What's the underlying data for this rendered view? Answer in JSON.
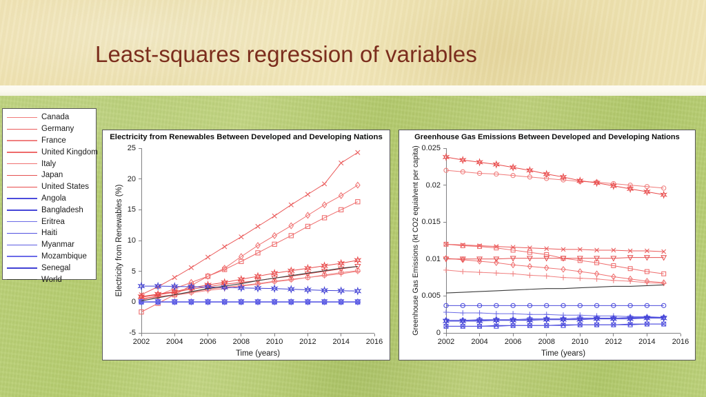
{
  "slide": {
    "title": "Least-squares regression of variables",
    "banner_color": "#efe2b2",
    "body_color": "#b6cd70",
    "title_color": "#7b2d1d"
  },
  "legend": {
    "developed_color": "#f0716f",
    "developing_color": "#4a4ae0",
    "world_color": "#3a3a3a",
    "items": [
      {
        "label": "Canada",
        "marker": "circle",
        "color": "#f07a79",
        "group": "developed"
      },
      {
        "label": "Germany",
        "marker": "x",
        "color": "#ea5a5a",
        "group": "developed"
      },
      {
        "label": "France",
        "marker": "plus",
        "color": "#f08080",
        "group": "developed"
      },
      {
        "label": "United Kingdom",
        "marker": "square",
        "color": "#ee6a6a",
        "group": "developed"
      },
      {
        "label": "Italy",
        "marker": "diamond",
        "color": "#ef6f6f",
        "group": "developed"
      },
      {
        "label": "Japan",
        "marker": "triangle",
        "color": "#e55050",
        "group": "developed"
      },
      {
        "label": "United States",
        "marker": "star",
        "color": "#e84a4a",
        "group": "developed"
      },
      {
        "label": "Angola",
        "marker": "circle",
        "color": "#4b4bdc",
        "group": "developing"
      },
      {
        "label": "Bangladesh",
        "marker": "x",
        "color": "#4545d8",
        "group": "developing"
      },
      {
        "label": "Eritrea",
        "marker": "plus",
        "color": "#6a6ae6",
        "group": "developing"
      },
      {
        "label": "Haiti",
        "marker": "square",
        "color": "#5050e0",
        "group": "developing"
      },
      {
        "label": "Myanmar",
        "marker": "diamond",
        "color": "#5a5ae2",
        "group": "developing"
      },
      {
        "label": "Mozambique",
        "marker": "triangle",
        "color": "#6b6be8",
        "group": "developing"
      },
      {
        "label": "Senegal",
        "marker": "star",
        "color": "#4040d4",
        "group": "developing"
      },
      {
        "label": "World",
        "marker": "none",
        "color": "#3a3a3a",
        "group": "world"
      }
    ]
  },
  "chart_data": [
    {
      "id": "electricity",
      "type": "line",
      "title": "Electricity from Renewables Between Developed and Developing Nations",
      "xlabel": "Time (years)",
      "ylabel": "Electricity from Renewables (%)",
      "xlim": [
        2002,
        2016
      ],
      "ylim": [
        -5,
        25
      ],
      "xticks": [
        2002,
        2004,
        2006,
        2008,
        2010,
        2012,
        2014,
        2016
      ],
      "yticks": [
        -5,
        0,
        5,
        10,
        15,
        20,
        25
      ],
      "grid": false,
      "legend_position": "external-left",
      "x": [
        2002,
        2003,
        2004,
        2005,
        2006,
        2007,
        2008,
        2009,
        2010,
        2011,
        2012,
        2013,
        2014,
        2015
      ],
      "series": [
        {
          "name": "Canada",
          "marker": "circle",
          "color": "#f07a79",
          "values": [
            0.6,
            0.9,
            1.2,
            1.6,
            2.1,
            2.4,
            2.7,
            3.0,
            3.4,
            3.7,
            4.0,
            4.4,
            4.8,
            5.1
          ]
        },
        {
          "name": "Germany",
          "marker": "x",
          "color": "#ea5a5a",
          "values": [
            1.2,
            2.5,
            4.0,
            5.6,
            7.3,
            9.0,
            10.6,
            12.3,
            14.0,
            15.8,
            17.5,
            19.2,
            22.6,
            24.3
          ]
        },
        {
          "name": "France",
          "marker": "plus",
          "color": "#f08080",
          "values": [
            0.5,
            0.8,
            1.1,
            1.5,
            1.9,
            2.2,
            2.6,
            2.9,
            3.3,
            3.6,
            4.0,
            4.3,
            4.6,
            5.0
          ]
        },
        {
          "name": "United Kingdom",
          "marker": "square",
          "color": "#ee6a6a",
          "values": [
            -1.6,
            -0.2,
            1.2,
            2.7,
            4.2,
            5.3,
            6.6,
            8.0,
            9.4,
            10.8,
            12.3,
            13.7,
            15.0,
            16.3
          ]
        },
        {
          "name": "Italy",
          "marker": "diamond",
          "color": "#ef6f6f",
          "values": [
            0.3,
            1.1,
            2.2,
            3.2,
            4.2,
            5.5,
            7.4,
            9.2,
            10.8,
            12.4,
            14.1,
            15.8,
            17.3,
            19.0
          ]
        },
        {
          "name": "Japan",
          "marker": "triangle",
          "color": "#e55050",
          "values": [
            0.8,
            1.2,
            1.6,
            2.1,
            2.5,
            2.9,
            3.2,
            3.5,
            3.9,
            4.2,
            4.6,
            5.0,
            5.4,
            5.8
          ]
        },
        {
          "name": "United States",
          "marker": "star",
          "color": "#e84a4a",
          "values": [
            0.9,
            1.3,
            1.7,
            2.3,
            2.8,
            3.2,
            3.7,
            4.2,
            4.7,
            5.1,
            5.5,
            5.9,
            6.3,
            6.8
          ]
        },
        {
          "name": "Angola",
          "marker": "circle",
          "color": "#4b4bdc",
          "values": [
            0.05,
            0.05,
            0.05,
            0.05,
            0.05,
            0.05,
            0.05,
            0.05,
            0.05,
            0.05,
            0.05,
            0.05,
            0.05,
            0.05
          ]
        },
        {
          "name": "Bangladesh",
          "marker": "x",
          "color": "#4545d8",
          "values": [
            0.02,
            0.02,
            0.02,
            0.02,
            0.02,
            0.02,
            0.02,
            0.02,
            0.02,
            0.02,
            0.02,
            0.02,
            0.02,
            0.02
          ]
        },
        {
          "name": "Eritrea",
          "marker": "plus",
          "color": "#6a6ae6",
          "values": [
            0.0,
            0.0,
            0.0,
            0.0,
            0.0,
            0.0,
            0.0,
            0.0,
            0.0,
            0.0,
            0.0,
            0.0,
            0.0,
            0.0
          ]
        },
        {
          "name": "Haiti",
          "marker": "square",
          "color": "#5050e0",
          "values": [
            0.03,
            0.03,
            0.03,
            0.03,
            0.03,
            0.03,
            0.03,
            0.03,
            0.03,
            0.03,
            0.03,
            0.03,
            0.03,
            0.03
          ]
        },
        {
          "name": "Myanmar",
          "marker": "diamond",
          "color": "#5a5ae2",
          "values": [
            0.04,
            0.04,
            0.04,
            0.04,
            0.04,
            0.04,
            0.04,
            0.04,
            0.04,
            0.04,
            0.04,
            0.04,
            0.04,
            0.04
          ]
        },
        {
          "name": "Mozambique",
          "marker": "triangle",
          "color": "#6b6be8",
          "values": [
            0.06,
            0.06,
            0.06,
            0.06,
            0.06,
            0.06,
            0.06,
            0.06,
            0.06,
            0.06,
            0.06,
            0.06,
            0.06,
            0.06
          ]
        },
        {
          "name": "Senegal",
          "marker": "star",
          "color": "#4040d4",
          "values": [
            2.6,
            2.6,
            2.55,
            2.5,
            2.45,
            2.4,
            2.3,
            2.25,
            2.2,
            2.1,
            2.0,
            1.9,
            1.85,
            1.8
          ]
        },
        {
          "name": "World",
          "marker": "none",
          "color": "#3a3a3a",
          "values": [
            0.2,
            0.7,
            1.2,
            1.7,
            2.2,
            2.6,
            3.0,
            3.5,
            3.9,
            4.3,
            4.7,
            5.1,
            5.5,
            5.8
          ]
        }
      ]
    },
    {
      "id": "emissions",
      "type": "line",
      "title": "Greenhouse Gas Emissions Between Developed and Developing Nations",
      "xlabel": "Time (years)",
      "ylabel": "Greenhouse Gas Emissions (kt CO2 equialvent per capita)",
      "xlim": [
        2002,
        2016
      ],
      "ylim": [
        0,
        0.025
      ],
      "xticks": [
        2002,
        2004,
        2006,
        2008,
        2010,
        2012,
        2014,
        2016
      ],
      "yticks": [
        0,
        0.005,
        0.01,
        0.015,
        0.02,
        0.025
      ],
      "grid": false,
      "legend_position": "external-left",
      "x": [
        2002,
        2003,
        2004,
        2005,
        2006,
        2007,
        2008,
        2009,
        2010,
        2011,
        2012,
        2013,
        2014,
        2015
      ],
      "series": [
        {
          "name": "Canada",
          "marker": "circle",
          "color": "#f07a79",
          "values": [
            0.022,
            0.0218,
            0.0216,
            0.0215,
            0.0213,
            0.0211,
            0.0209,
            0.0207,
            0.0205,
            0.0204,
            0.0202,
            0.02,
            0.0198,
            0.0196
          ]
        },
        {
          "name": "Germany",
          "marker": "x",
          "color": "#ea5a5a",
          "values": [
            0.012,
            0.0119,
            0.0118,
            0.0117,
            0.0116,
            0.0115,
            0.0114,
            0.0113,
            0.0113,
            0.0112,
            0.0112,
            0.0111,
            0.0111,
            0.011
          ]
        },
        {
          "name": "France",
          "marker": "plus",
          "color": "#f08080",
          "values": [
            0.0085,
            0.0083,
            0.0082,
            0.0081,
            0.008,
            0.0078,
            0.0077,
            0.0075,
            0.0074,
            0.0073,
            0.0071,
            0.007,
            0.0068,
            0.0067
          ]
        },
        {
          "name": "United Kingdom",
          "marker": "square",
          "color": "#ee6a6a",
          "values": [
            0.012,
            0.0118,
            0.0117,
            0.0115,
            0.0112,
            0.0109,
            0.0106,
            0.0101,
            0.0098,
            0.0095,
            0.0091,
            0.0087,
            0.0083,
            0.008
          ]
        },
        {
          "name": "Italy",
          "marker": "diamond",
          "color": "#ef6f6f",
          "values": [
            0.0101,
            0.0099,
            0.0097,
            0.0095,
            0.0092,
            0.009,
            0.0088,
            0.0086,
            0.0083,
            0.008,
            0.0076,
            0.0073,
            0.007,
            0.0068
          ]
        },
        {
          "name": "Japan",
          "marker": "triangle",
          "color": "#e55050",
          "values": [
            0.01,
            0.01,
            0.01,
            0.01,
            0.0101,
            0.0101,
            0.0101,
            0.0101,
            0.0101,
            0.0101,
            0.0101,
            0.0102,
            0.0102,
            0.0102
          ]
        },
        {
          "name": "United States",
          "marker": "star",
          "color": "#e84a4a",
          "values": [
            0.0238,
            0.0234,
            0.0231,
            0.0228,
            0.0224,
            0.022,
            0.0215,
            0.0211,
            0.0206,
            0.0203,
            0.0199,
            0.0195,
            0.0191,
            0.0187
          ]
        },
        {
          "name": "Angola",
          "marker": "circle",
          "color": "#4b4bdc",
          "values": [
            0.0037,
            0.0037,
            0.0037,
            0.0037,
            0.0037,
            0.0037,
            0.0037,
            0.0037,
            0.0037,
            0.0037,
            0.0037,
            0.0037,
            0.0037,
            0.0037
          ]
        },
        {
          "name": "Bangladesh",
          "marker": "x",
          "color": "#4545d8",
          "values": [
            0.0009,
            0.0009,
            0.0009,
            0.001,
            0.001,
            0.001,
            0.001,
            0.0011,
            0.0011,
            0.0011,
            0.0011,
            0.0012,
            0.0012,
            0.0012
          ]
        },
        {
          "name": "Eritrea",
          "marker": "plus",
          "color": "#6a6ae6",
          "values": [
            0.0028,
            0.0027,
            0.0027,
            0.0026,
            0.0026,
            0.0025,
            0.0025,
            0.0024,
            0.0024,
            0.0023,
            0.0023,
            0.0022,
            0.0022,
            0.0021
          ]
        },
        {
          "name": "Haiti",
          "marker": "square",
          "color": "#5050e0",
          "values": [
            0.0009,
            0.0009,
            0.0009,
            0.0009,
            0.001,
            0.001,
            0.001,
            0.001,
            0.0011,
            0.0011,
            0.0011,
            0.0011,
            0.0012,
            0.0012
          ]
        },
        {
          "name": "Myanmar",
          "marker": "diamond",
          "color": "#5a5ae2",
          "values": [
            0.0017,
            0.0017,
            0.0018,
            0.0018,
            0.0018,
            0.0019,
            0.0019,
            0.0019,
            0.002,
            0.002,
            0.002,
            0.0021,
            0.0021,
            0.0021
          ]
        },
        {
          "name": "Mozambique",
          "marker": "triangle",
          "color": "#6b6be8",
          "values": [
            0.0016,
            0.0016,
            0.0017,
            0.0017,
            0.0017,
            0.0018,
            0.0018,
            0.0018,
            0.0019,
            0.0019,
            0.0019,
            0.002,
            0.002,
            0.002
          ]
        },
        {
          "name": "Senegal",
          "marker": "star",
          "color": "#4040d4",
          "values": [
            0.0016,
            0.0016,
            0.0016,
            0.0017,
            0.0017,
            0.0017,
            0.0018,
            0.0018,
            0.0018,
            0.0019,
            0.0019,
            0.0019,
            0.002,
            0.002
          ]
        },
        {
          "name": "World",
          "marker": "none",
          "color": "#3a3a3a",
          "values": [
            0.0054,
            0.0055,
            0.0056,
            0.0057,
            0.0058,
            0.0059,
            0.006,
            0.006,
            0.0061,
            0.0062,
            0.0063,
            0.0063,
            0.0064,
            0.0065
          ]
        }
      ]
    }
  ]
}
